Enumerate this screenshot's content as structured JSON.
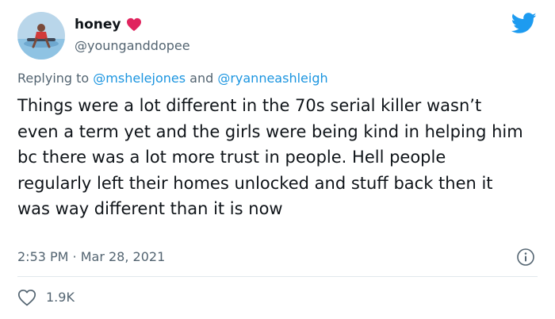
{
  "author": {
    "display_name": "honey",
    "handle": "@younganddopee"
  },
  "reply": {
    "prefix": "Replying to ",
    "mention1": "@mshelejones",
    "joiner": " and ",
    "mention2": "@ryanneashleigh"
  },
  "tweet": {
    "text": "Things were a lot different in the 70s serial killer wasn’t even a term yet and the girls were being kind in helping him bc there was a lot more trust in people. Hell people regularly left their homes unlocked and stuff back then it was way different than it is now",
    "timestamp": "2:53 PM · Mar 28, 2021",
    "likes": "1.9K"
  },
  "icons": {
    "heart": "heart-icon",
    "brand": "twitter-bird-icon",
    "info": "info-icon",
    "like": "like-outline-icon"
  },
  "colors": {
    "text": "#0f1419",
    "secondary": "#536471",
    "mention": "#1b95e0",
    "brand": "#1d9bf0",
    "heart": "#e0245e"
  }
}
